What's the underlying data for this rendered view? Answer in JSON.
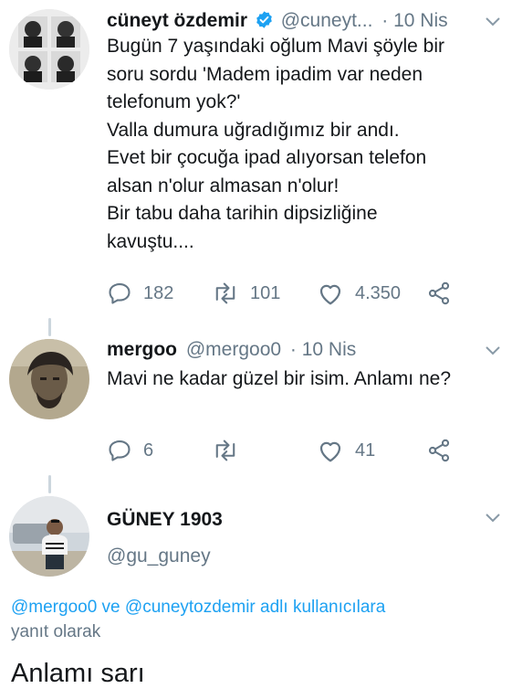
{
  "tweet1": {
    "name": "cüneyt özdemir",
    "handle": "@cuneyt...",
    "time": "· 10 Nis",
    "text_lines": [
      "Bugün 7 yaşındaki oğlum Mavi şöyle bir",
      "soru sordu 'Madem ipadim var neden",
      "telefonum yok?'",
      "Valla dumura uğradığımız bir andı.",
      "Evet bir çocuğa ipad alıyorsan telefon",
      "alsan n'olur almasan n'olur!",
      "Bir tabu daha tarihin dipsizliğine",
      "kavuştu...."
    ],
    "replies": "182",
    "retweets": "101",
    "likes": "4.350"
  },
  "tweet2": {
    "name": "mergoo",
    "handle": "@mergoo0",
    "time": "· 10 Nis",
    "text": "Mavi ne kadar güzel bir isim. Anlamı ne?",
    "replies": "6",
    "likes": "41"
  },
  "tweet3": {
    "name": "GÜNEY 1903",
    "handle": "@gu_guney",
    "reply_mention1": "@mergoo0",
    "reply_and": " ve ",
    "reply_mention2": "@cuneytozdemir",
    "reply_suffix": " adlı kullanıcılara",
    "reply_line2": "yanıt olarak",
    "text": "Anlamı sarı"
  },
  "colors": {
    "accent": "#1da1f2",
    "secondary_text": "#657786",
    "verified": "#1da1f2"
  }
}
